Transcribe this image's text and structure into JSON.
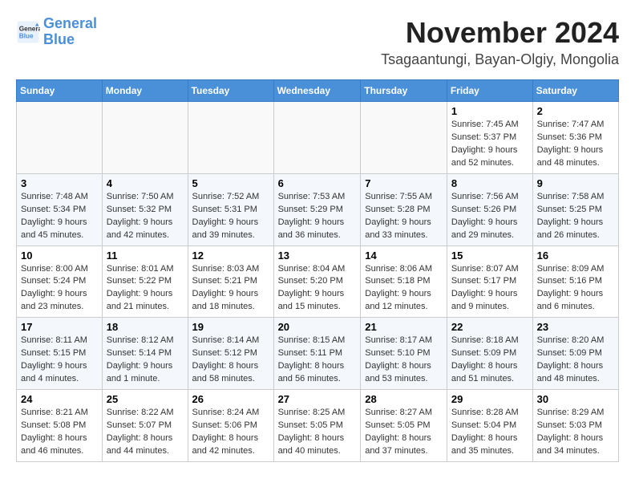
{
  "header": {
    "logo_line1": "General",
    "logo_line2": "Blue",
    "month": "November 2024",
    "location": "Tsagaantungi, Bayan-Olgiy, Mongolia"
  },
  "weekdays": [
    "Sunday",
    "Monday",
    "Tuesday",
    "Wednesday",
    "Thursday",
    "Friday",
    "Saturday"
  ],
  "weeks": [
    [
      {
        "day": "",
        "info": ""
      },
      {
        "day": "",
        "info": ""
      },
      {
        "day": "",
        "info": ""
      },
      {
        "day": "",
        "info": ""
      },
      {
        "day": "",
        "info": ""
      },
      {
        "day": "1",
        "info": "Sunrise: 7:45 AM\nSunset: 5:37 PM\nDaylight: 9 hours\nand 52 minutes."
      },
      {
        "day": "2",
        "info": "Sunrise: 7:47 AM\nSunset: 5:36 PM\nDaylight: 9 hours\nand 48 minutes."
      }
    ],
    [
      {
        "day": "3",
        "info": "Sunrise: 7:48 AM\nSunset: 5:34 PM\nDaylight: 9 hours\nand 45 minutes."
      },
      {
        "day": "4",
        "info": "Sunrise: 7:50 AM\nSunset: 5:32 PM\nDaylight: 9 hours\nand 42 minutes."
      },
      {
        "day": "5",
        "info": "Sunrise: 7:52 AM\nSunset: 5:31 PM\nDaylight: 9 hours\nand 39 minutes."
      },
      {
        "day": "6",
        "info": "Sunrise: 7:53 AM\nSunset: 5:29 PM\nDaylight: 9 hours\nand 36 minutes."
      },
      {
        "day": "7",
        "info": "Sunrise: 7:55 AM\nSunset: 5:28 PM\nDaylight: 9 hours\nand 33 minutes."
      },
      {
        "day": "8",
        "info": "Sunrise: 7:56 AM\nSunset: 5:26 PM\nDaylight: 9 hours\nand 29 minutes."
      },
      {
        "day": "9",
        "info": "Sunrise: 7:58 AM\nSunset: 5:25 PM\nDaylight: 9 hours\nand 26 minutes."
      }
    ],
    [
      {
        "day": "10",
        "info": "Sunrise: 8:00 AM\nSunset: 5:24 PM\nDaylight: 9 hours\nand 23 minutes."
      },
      {
        "day": "11",
        "info": "Sunrise: 8:01 AM\nSunset: 5:22 PM\nDaylight: 9 hours\nand 21 minutes."
      },
      {
        "day": "12",
        "info": "Sunrise: 8:03 AM\nSunset: 5:21 PM\nDaylight: 9 hours\nand 18 minutes."
      },
      {
        "day": "13",
        "info": "Sunrise: 8:04 AM\nSunset: 5:20 PM\nDaylight: 9 hours\nand 15 minutes."
      },
      {
        "day": "14",
        "info": "Sunrise: 8:06 AM\nSunset: 5:18 PM\nDaylight: 9 hours\nand 12 minutes."
      },
      {
        "day": "15",
        "info": "Sunrise: 8:07 AM\nSunset: 5:17 PM\nDaylight: 9 hours\nand 9 minutes."
      },
      {
        "day": "16",
        "info": "Sunrise: 8:09 AM\nSunset: 5:16 PM\nDaylight: 9 hours\nand 6 minutes."
      }
    ],
    [
      {
        "day": "17",
        "info": "Sunrise: 8:11 AM\nSunset: 5:15 PM\nDaylight: 9 hours\nand 4 minutes."
      },
      {
        "day": "18",
        "info": "Sunrise: 8:12 AM\nSunset: 5:14 PM\nDaylight: 9 hours\nand 1 minute."
      },
      {
        "day": "19",
        "info": "Sunrise: 8:14 AM\nSunset: 5:12 PM\nDaylight: 8 hours\nand 58 minutes."
      },
      {
        "day": "20",
        "info": "Sunrise: 8:15 AM\nSunset: 5:11 PM\nDaylight: 8 hours\nand 56 minutes."
      },
      {
        "day": "21",
        "info": "Sunrise: 8:17 AM\nSunset: 5:10 PM\nDaylight: 8 hours\nand 53 minutes."
      },
      {
        "day": "22",
        "info": "Sunrise: 8:18 AM\nSunset: 5:09 PM\nDaylight: 8 hours\nand 51 minutes."
      },
      {
        "day": "23",
        "info": "Sunrise: 8:20 AM\nSunset: 5:09 PM\nDaylight: 8 hours\nand 48 minutes."
      }
    ],
    [
      {
        "day": "24",
        "info": "Sunrise: 8:21 AM\nSunset: 5:08 PM\nDaylight: 8 hours\nand 46 minutes."
      },
      {
        "day": "25",
        "info": "Sunrise: 8:22 AM\nSunset: 5:07 PM\nDaylight: 8 hours\nand 44 minutes."
      },
      {
        "day": "26",
        "info": "Sunrise: 8:24 AM\nSunset: 5:06 PM\nDaylight: 8 hours\nand 42 minutes."
      },
      {
        "day": "27",
        "info": "Sunrise: 8:25 AM\nSunset: 5:05 PM\nDaylight: 8 hours\nand 40 minutes."
      },
      {
        "day": "28",
        "info": "Sunrise: 8:27 AM\nSunset: 5:05 PM\nDaylight: 8 hours\nand 37 minutes."
      },
      {
        "day": "29",
        "info": "Sunrise: 8:28 AM\nSunset: 5:04 PM\nDaylight: 8 hours\nand 35 minutes."
      },
      {
        "day": "30",
        "info": "Sunrise: 8:29 AM\nSunset: 5:03 PM\nDaylight: 8 hours\nand 34 minutes."
      }
    ]
  ]
}
